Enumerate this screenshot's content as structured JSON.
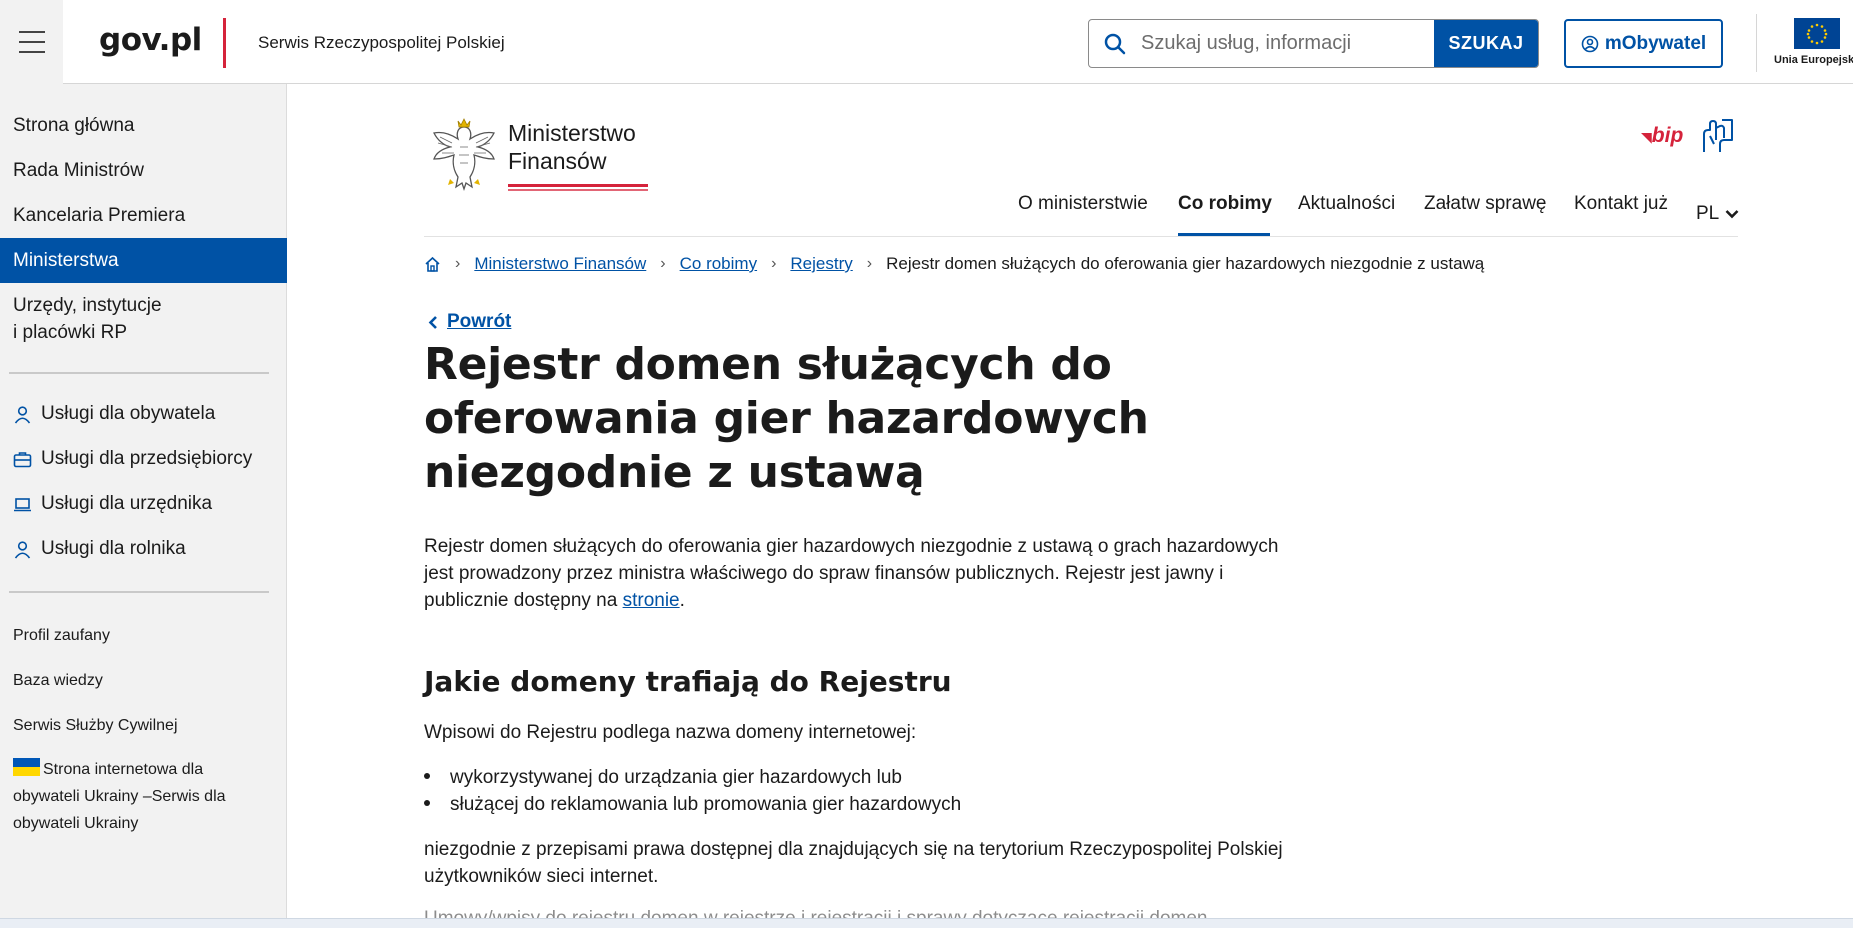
{
  "header": {
    "logo": "gov.pl",
    "serwis": "Serwis Rzeczypospolitej Polskiej",
    "search_placeholder": "Szukaj usług, informacji",
    "search_button": "SZUKAJ",
    "mobywatel": "mObywatel",
    "eu_caption": "Unia Europejska"
  },
  "sidebar": {
    "main_items": [
      "Strona główna",
      "Rada Ministrów",
      "Kancelaria Premiera",
      "Ministerstwa",
      "Urzędy, instytucje",
      "i placówki RP"
    ],
    "services": [
      "Usługi dla obywatela",
      "Usługi dla przedsiębiorcy",
      "Usługi dla urzędnika",
      "Usługi dla rolnika"
    ],
    "links": [
      "Profil zaufany",
      "Baza wiedzy",
      "Serwis Służby Cywilnej"
    ],
    "ukraine": [
      "Strona internetowa dla",
      "obywateli Ukrainy –Serwis dla",
      "obywateli Ukrainy"
    ]
  },
  "ministry": {
    "line1": "Ministerstwo",
    "line2": "Finansów",
    "bip": "bip"
  },
  "topnav": [
    "O ministerstwie",
    "Co robimy",
    "Aktualności",
    "Załatw sprawę",
    "Kontakt już",
    "PL"
  ],
  "breadcrumb": [
    "Ministerstwo Finansów",
    "Co robimy",
    "Rejestry",
    "Rejestr domen służących do oferowania gier hazardowych niezgodnie z ustawą"
  ],
  "back": "Powrót",
  "title": [
    "Rejestr domen służących do",
    "oferowania gier hazardowych",
    "niezgodnie z ustawą"
  ],
  "intro": {
    "line1": "Rejestr domen służących do oferowania gier hazardowych niezgodnie z ustawą o grach hazardowych",
    "line2": "jest prowadzony przez ministra właściwego do spraw finansów publicznych. Rejestr jest jawny i",
    "line3_pre": "publicznie dostępny na ",
    "line3_link": "stronie",
    "line3_post": "."
  },
  "section": {
    "heading": "Jakie domeny trafiają do Rejestru",
    "lead": "Wpisowi do Rejestru podlega nazwa domeny internetowej:",
    "bullets": [
      "wykorzystywanej do urządzania gier hazardowych lub",
      "służącej do reklamowania lub promowania gier hazardowych"
    ],
    "after1": "niezgodnie z przepisami prawa dostępnej dla znajdujących się na terytorium Rzeczypospolitej Polskiej",
    "after2": "użytkowników sieci internet.",
    "cut": "Umowy/wpisy do rejestru domen w rejestrze i rejestracji i sprawy dotyczące rejestracji domen"
  }
}
